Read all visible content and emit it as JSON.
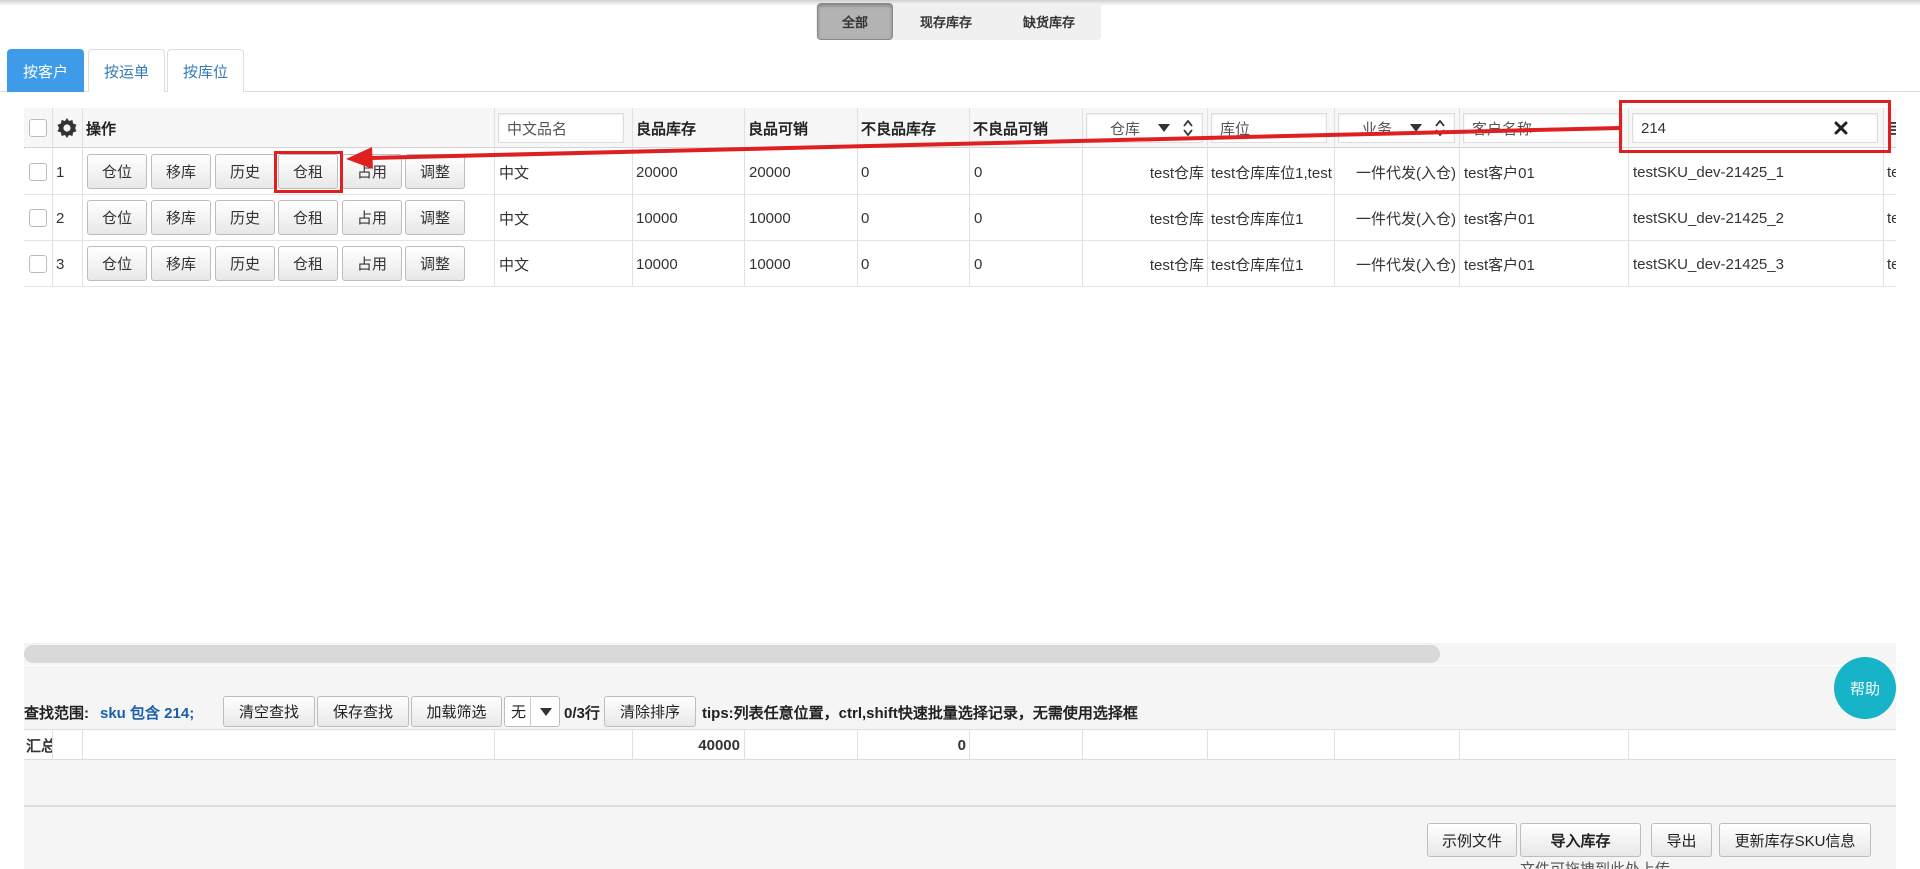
{
  "filter_segments": [
    {
      "label": "全部",
      "active": true
    },
    {
      "label": "现存库存",
      "active": false
    },
    {
      "label": "缺货库存",
      "active": false
    }
  ],
  "tabs": [
    {
      "label": "按客户",
      "active": true
    },
    {
      "label": "按运单",
      "active": false
    },
    {
      "label": "按库位",
      "active": false
    }
  ],
  "grid": {
    "headers": {
      "ops": "操作",
      "cn_name": "中文品名",
      "good_stock": "良品库存",
      "good_sellable": "良品可销",
      "bad_stock": "不良品库存",
      "bad_sellable": "不良品可销",
      "warehouse": "仓库",
      "location": "库位",
      "business": "业务",
      "customer": "客户名称",
      "sku_filter": "214",
      "last_partial": "目"
    },
    "op_buttons": [
      "仓位",
      "移库",
      "历史",
      "仓租",
      "占用",
      "调整"
    ],
    "rows": [
      {
        "no": "1",
        "cn_name": "中文",
        "good_stock": "20000",
        "good_sellable": "20000",
        "bad_stock": "0",
        "bad_sellable": "0",
        "warehouse": "test仓库",
        "location": "test仓库库位1,test",
        "business": "一件代发(入仓)",
        "customer": "test客户01",
        "sku": "testSKU_dev-21425_1",
        "last": "te"
      },
      {
        "no": "2",
        "cn_name": "中文",
        "good_stock": "10000",
        "good_sellable": "10000",
        "bad_stock": "0",
        "bad_sellable": "0",
        "warehouse": "test仓库",
        "location": "test仓库库位1",
        "business": "一件代发(入仓)",
        "customer": "test客户01",
        "sku": "testSKU_dev-21425_2",
        "last": "te"
      },
      {
        "no": "3",
        "cn_name": "中文",
        "good_stock": "10000",
        "good_sellable": "10000",
        "bad_stock": "0",
        "bad_sellable": "0",
        "warehouse": "test仓库",
        "location": "test仓库库位1",
        "business": "一件代发(入仓)",
        "customer": "test客户01",
        "sku": "testSKU_dev-21425_3",
        "last": "te"
      }
    ]
  },
  "toolbar": {
    "search_scope_label": "查找范围:",
    "search_scope_value": "sku 包含 214;",
    "clear_search": "清空查找",
    "save_search": "保存查找",
    "load_filter": "加载筛选",
    "filter_select": "无",
    "row_count": "0/3行",
    "clear_sort": "清除排序",
    "tips": "tips:列表任意位置，ctrl,shift快速批量选择记录，无需使用选择框"
  },
  "summary": {
    "label": "汇总",
    "good_stock_total": "40000",
    "bad_stock_total": "0"
  },
  "help_label": "帮助",
  "bottom_buttons": {
    "sample_file": "示例文件",
    "import_stock": "导入库存",
    "export": "导出",
    "update_sku": "更新库存SKU信息"
  },
  "upload_hint": "文件可拖拽到此处上传",
  "colors": {
    "accent": "#3d9be9",
    "annotation": "#e02020",
    "help": "#17b4c9",
    "link": "#1a5fa8"
  }
}
